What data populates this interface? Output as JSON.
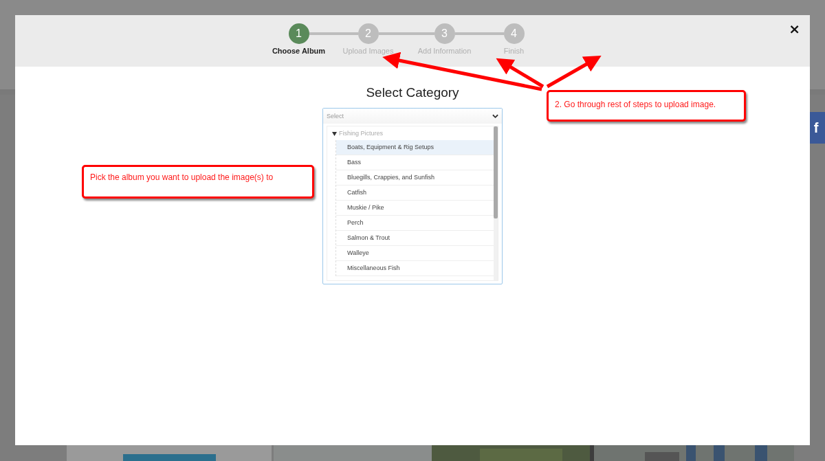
{
  "steps": [
    {
      "number": "1",
      "label": "Choose Album",
      "selected": true
    },
    {
      "number": "2",
      "label": "Upload Images",
      "selected": false
    },
    {
      "number": "3",
      "label": "Add Information",
      "selected": false
    },
    {
      "number": "4",
      "label": "Finish",
      "selected": false
    }
  ],
  "close": "×",
  "title": "Select Category",
  "select": {
    "placeholder": "Select",
    "expanded": true
  },
  "tree": {
    "label": "Fishing Pictures",
    "expanded": true,
    "children": [
      {
        "label": "Boats, Equipment & Rig Setups",
        "selected": true
      },
      {
        "label": "Bass",
        "selected": false
      },
      {
        "label": "Bluegills, Crappies, and Sunfish",
        "selected": false
      },
      {
        "label": "Catfish",
        "selected": false
      },
      {
        "label": "Muskie / Pike",
        "selected": false
      },
      {
        "label": "Perch",
        "selected": false
      },
      {
        "label": "Salmon & Trout",
        "selected": false
      },
      {
        "label": "Walleye",
        "selected": false
      },
      {
        "label": "Miscellaneous Fish",
        "selected": false
      }
    ]
  },
  "callouts": [
    "Pick the album you want to upload the image(s) to",
    "2. Go through rest of steps to upload image."
  ],
  "facebook": "f"
}
